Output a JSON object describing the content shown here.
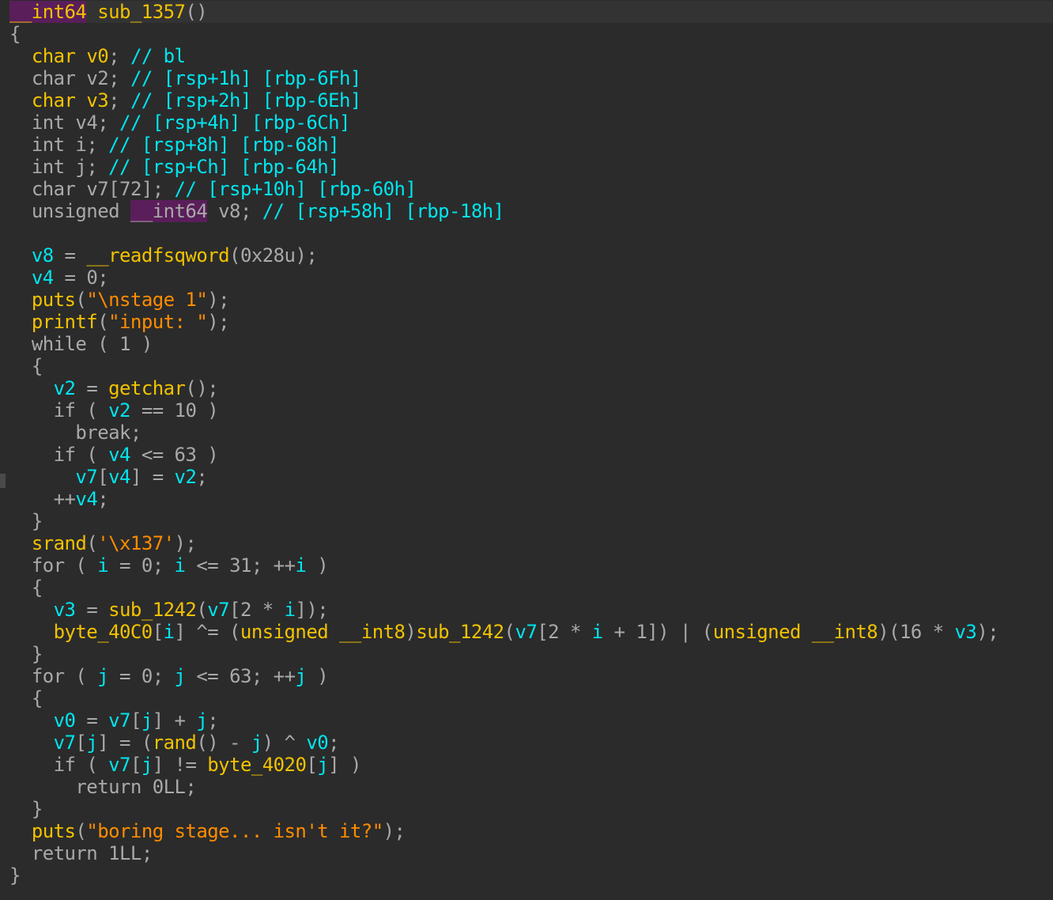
{
  "lines": [
    {
      "indent": "",
      "tokens": [
        [
          "__int64",
          "hl"
        ],
        [
          " ",
          "pun"
        ],
        [
          "sub_1357",
          "func"
        ],
        [
          "()",
          "pun"
        ]
      ]
    },
    {
      "indent": "",
      "tokens": [
        [
          "{",
          "pun"
        ]
      ]
    },
    {
      "indent": "  ",
      "tokens": [
        [
          "char",
          "kwy"
        ],
        [
          " ",
          "pun"
        ],
        [
          "v0",
          "glob"
        ],
        [
          ";",
          "pun"
        ],
        [
          " // bl",
          "com"
        ]
      ]
    },
    {
      "indent": "  ",
      "tokens": [
        [
          "char",
          "kw"
        ],
        [
          " ",
          "pun"
        ],
        [
          "v2",
          "kw"
        ],
        [
          ";",
          "pun"
        ],
        [
          " // [rsp+1h] [rbp-6Fh]",
          "com"
        ]
      ]
    },
    {
      "indent": "  ",
      "tokens": [
        [
          "char",
          "kwy"
        ],
        [
          " ",
          "pun"
        ],
        [
          "v3",
          "glob"
        ],
        [
          ";",
          "pun"
        ],
        [
          " // [rsp+2h] [rbp-6Eh]",
          "com"
        ]
      ]
    },
    {
      "indent": "  ",
      "tokens": [
        [
          "int",
          "kw"
        ],
        [
          " ",
          "pun"
        ],
        [
          "v4",
          "kw"
        ],
        [
          ";",
          "pun"
        ],
        [
          " // [rsp+4h] [rbp-6Ch]",
          "com"
        ]
      ]
    },
    {
      "indent": "  ",
      "tokens": [
        [
          "int",
          "kw"
        ],
        [
          " ",
          "pun"
        ],
        [
          "i",
          "kw"
        ],
        [
          ";",
          "pun"
        ],
        [
          " // [rsp+8h] [rbp-68h]",
          "com"
        ]
      ]
    },
    {
      "indent": "  ",
      "tokens": [
        [
          "int",
          "kw"
        ],
        [
          " ",
          "pun"
        ],
        [
          "j",
          "kw"
        ],
        [
          ";",
          "pun"
        ],
        [
          " // [rsp+Ch] [rbp-64h]",
          "com"
        ]
      ]
    },
    {
      "indent": "  ",
      "tokens": [
        [
          "char",
          "kw"
        ],
        [
          " ",
          "pun"
        ],
        [
          "v7",
          "kw"
        ],
        [
          "[72]",
          "pun"
        ],
        [
          ";",
          "pun"
        ],
        [
          " // [rsp+10h] [rbp-60h]",
          "com"
        ]
      ]
    },
    {
      "indent": "  ",
      "tokens": [
        [
          "unsigned",
          "kw"
        ],
        [
          " ",
          "pun"
        ],
        [
          "__int64",
          "hl2"
        ],
        [
          " ",
          "pun"
        ],
        [
          "v8",
          "kw"
        ],
        [
          ";",
          "pun"
        ],
        [
          " // [rsp+58h] [rbp-18h]",
          "com"
        ]
      ]
    },
    {
      "indent": "",
      "tokens": []
    },
    {
      "indent": "  ",
      "tokens": [
        [
          "v8",
          "var"
        ],
        [
          " = ",
          "pun"
        ],
        [
          "__readfsqword",
          "func"
        ],
        [
          "(",
          "pun"
        ],
        [
          "0x28u",
          "num"
        ],
        [
          ");",
          "pun"
        ]
      ]
    },
    {
      "indent": "  ",
      "tokens": [
        [
          "v4",
          "var"
        ],
        [
          " = ",
          "pun"
        ],
        [
          "0",
          "num"
        ],
        [
          ";",
          "pun"
        ]
      ]
    },
    {
      "indent": "  ",
      "tokens": [
        [
          "puts",
          "func"
        ],
        [
          "(",
          "pun"
        ],
        [
          "\"\\nstage 1\"",
          "str"
        ],
        [
          ");",
          "pun"
        ]
      ]
    },
    {
      "indent": "  ",
      "tokens": [
        [
          "printf",
          "func"
        ],
        [
          "(",
          "pun"
        ],
        [
          "\"input: \"",
          "str"
        ],
        [
          ");",
          "pun"
        ]
      ]
    },
    {
      "indent": "  ",
      "tokens": [
        [
          "while",
          "kw"
        ],
        [
          " ( ",
          "pun"
        ],
        [
          "1",
          "num"
        ],
        [
          " )",
          "pun"
        ]
      ]
    },
    {
      "indent": "  ",
      "tokens": [
        [
          "{",
          "pun"
        ]
      ]
    },
    {
      "indent": "    ",
      "tokens": [
        [
          "v2",
          "var"
        ],
        [
          " = ",
          "pun"
        ],
        [
          "getchar",
          "func"
        ],
        [
          "();",
          "pun"
        ]
      ]
    },
    {
      "indent": "    ",
      "tokens": [
        [
          "if",
          "kw"
        ],
        [
          " ( ",
          "pun"
        ],
        [
          "v2",
          "var"
        ],
        [
          " == ",
          "pun"
        ],
        [
          "10",
          "num"
        ],
        [
          " )",
          "pun"
        ]
      ]
    },
    {
      "indent": "      ",
      "tokens": [
        [
          "break",
          "kw"
        ],
        [
          ";",
          "pun"
        ]
      ]
    },
    {
      "indent": "    ",
      "tokens": [
        [
          "if",
          "kw"
        ],
        [
          " ( ",
          "pun"
        ],
        [
          "v4",
          "var"
        ],
        [
          " <= ",
          "pun"
        ],
        [
          "63",
          "num"
        ],
        [
          " )",
          "pun"
        ]
      ]
    },
    {
      "indent": "      ",
      "tokens": [
        [
          "v7",
          "var"
        ],
        [
          "[",
          "pun"
        ],
        [
          "v4",
          "var"
        ],
        [
          "] = ",
          "pun"
        ],
        [
          "v2",
          "var"
        ],
        [
          ";",
          "pun"
        ]
      ]
    },
    {
      "indent": "    ",
      "tokens": [
        [
          "++",
          "pun"
        ],
        [
          "v4",
          "var"
        ],
        [
          ";",
          "pun"
        ]
      ]
    },
    {
      "indent": "  ",
      "tokens": [
        [
          "}",
          "pun"
        ]
      ]
    },
    {
      "indent": "  ",
      "tokens": [
        [
          "srand",
          "func"
        ],
        [
          "(",
          "pun"
        ],
        [
          "'\\x137'",
          "str"
        ],
        [
          ");",
          "pun"
        ]
      ]
    },
    {
      "indent": "  ",
      "tokens": [
        [
          "for",
          "kw"
        ],
        [
          " ( ",
          "pun"
        ],
        [
          "i",
          "var"
        ],
        [
          " = ",
          "pun"
        ],
        [
          "0",
          "num"
        ],
        [
          "; ",
          "pun"
        ],
        [
          "i",
          "var"
        ],
        [
          " <= ",
          "pun"
        ],
        [
          "31",
          "num"
        ],
        [
          "; ++",
          "pun"
        ],
        [
          "i",
          "var"
        ],
        [
          " )",
          "pun"
        ]
      ]
    },
    {
      "indent": "  ",
      "tokens": [
        [
          "{",
          "pun"
        ]
      ]
    },
    {
      "indent": "    ",
      "tokens": [
        [
          "v3",
          "var"
        ],
        [
          " = ",
          "pun"
        ],
        [
          "sub_1242",
          "func"
        ],
        [
          "(",
          "pun"
        ],
        [
          "v7",
          "var"
        ],
        [
          "[",
          "pun"
        ],
        [
          "2",
          "num"
        ],
        [
          " * ",
          "pun"
        ],
        [
          "i",
          "var"
        ],
        [
          "]);",
          "pun"
        ]
      ]
    },
    {
      "indent": "    ",
      "tokens": [
        [
          "byte_40C0",
          "func"
        ],
        [
          "[",
          "pun"
        ],
        [
          "i",
          "var"
        ],
        [
          "] ^= (",
          "pun"
        ],
        [
          "unsigned __int8",
          "kwy"
        ],
        [
          ")",
          "pun"
        ],
        [
          "sub_1242",
          "func"
        ],
        [
          "(",
          "pun"
        ],
        [
          "v7",
          "var"
        ],
        [
          "[",
          "pun"
        ],
        [
          "2",
          "num"
        ],
        [
          " * ",
          "pun"
        ],
        [
          "i",
          "var"
        ],
        [
          " + ",
          "pun"
        ],
        [
          "1",
          "num"
        ],
        [
          "]) | (",
          "pun"
        ],
        [
          "unsigned __int8",
          "kwy"
        ],
        [
          ")(",
          "pun"
        ],
        [
          "16",
          "num"
        ],
        [
          " * ",
          "pun"
        ],
        [
          "v3",
          "var"
        ],
        [
          ");",
          "pun"
        ]
      ]
    },
    {
      "indent": "  ",
      "tokens": [
        [
          "}",
          "pun"
        ]
      ]
    },
    {
      "indent": "  ",
      "tokens": [
        [
          "for",
          "kw"
        ],
        [
          " ( ",
          "pun"
        ],
        [
          "j",
          "var"
        ],
        [
          " = ",
          "pun"
        ],
        [
          "0",
          "num"
        ],
        [
          "; ",
          "pun"
        ],
        [
          "j",
          "var"
        ],
        [
          " <= ",
          "pun"
        ],
        [
          "63",
          "num"
        ],
        [
          "; ++",
          "pun"
        ],
        [
          "j",
          "var"
        ],
        [
          " )",
          "pun"
        ]
      ]
    },
    {
      "indent": "  ",
      "tokens": [
        [
          "{",
          "pun"
        ]
      ]
    },
    {
      "indent": "    ",
      "tokens": [
        [
          "v0",
          "var"
        ],
        [
          " = ",
          "pun"
        ],
        [
          "v7",
          "var"
        ],
        [
          "[",
          "pun"
        ],
        [
          "j",
          "var"
        ],
        [
          "] + ",
          "pun"
        ],
        [
          "j",
          "var"
        ],
        [
          ";",
          "pun"
        ]
      ]
    },
    {
      "indent": "    ",
      "tokens": [
        [
          "v7",
          "var"
        ],
        [
          "[",
          "pun"
        ],
        [
          "j",
          "var"
        ],
        [
          "] = (",
          "pun"
        ],
        [
          "rand",
          "func"
        ],
        [
          "() - ",
          "pun"
        ],
        [
          "j",
          "var"
        ],
        [
          ") ^ ",
          "pun"
        ],
        [
          "v0",
          "var"
        ],
        [
          ";",
          "pun"
        ]
      ]
    },
    {
      "indent": "    ",
      "tokens": [
        [
          "if",
          "kw"
        ],
        [
          " ( ",
          "pun"
        ],
        [
          "v7",
          "var"
        ],
        [
          "[",
          "pun"
        ],
        [
          "j",
          "var"
        ],
        [
          "] != ",
          "pun"
        ],
        [
          "byte_4020",
          "func"
        ],
        [
          "[",
          "pun"
        ],
        [
          "j",
          "var"
        ],
        [
          "] )",
          "pun"
        ]
      ]
    },
    {
      "indent": "      ",
      "tokens": [
        [
          "return",
          "kw"
        ],
        [
          " ",
          "pun"
        ],
        [
          "0LL",
          "num"
        ],
        [
          ";",
          "pun"
        ]
      ]
    },
    {
      "indent": "  ",
      "tokens": [
        [
          "}",
          "pun"
        ]
      ]
    },
    {
      "indent": "  ",
      "tokens": [
        [
          "puts",
          "func"
        ],
        [
          "(",
          "pun"
        ],
        [
          "\"boring stage... isn't it?\"",
          "str"
        ],
        [
          ");",
          "pun"
        ]
      ]
    },
    {
      "indent": "  ",
      "tokens": [
        [
          "return",
          "kw"
        ],
        [
          " ",
          "pun"
        ],
        [
          "1LL",
          "num"
        ],
        [
          ";",
          "pun"
        ]
      ]
    },
    {
      "indent": "",
      "tokens": [
        [
          "}",
          "pun"
        ]
      ]
    }
  ],
  "colors": {
    "background": "#2b2b2b",
    "keyword": "#a9a9a9",
    "identifier_yellow": "#f2c200",
    "variable_cyan": "#00e5ee",
    "string_orange": "#ff8c00",
    "highlight": "#5a1e5a"
  }
}
